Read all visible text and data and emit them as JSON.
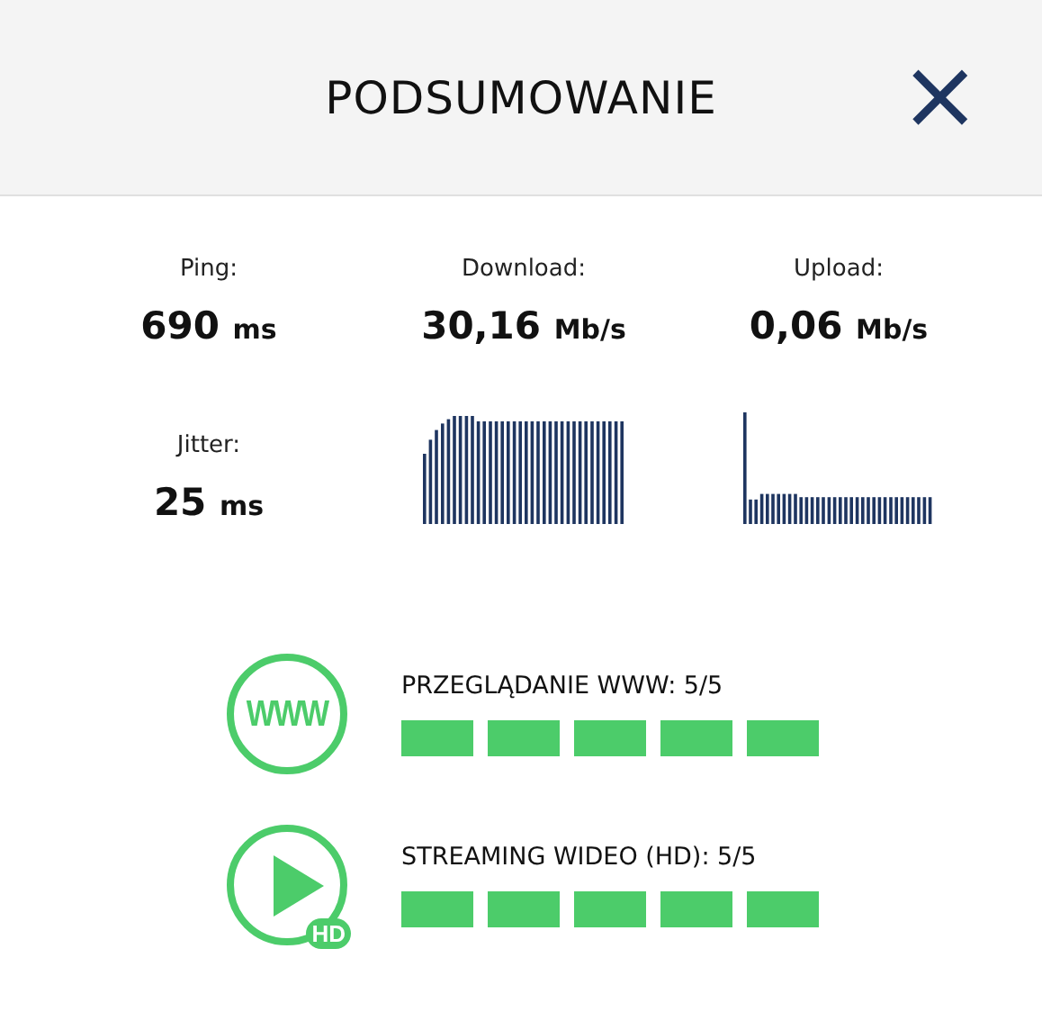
{
  "header": {
    "title": "PODSUMOWANIE",
    "close": "×"
  },
  "stats": [
    {
      "label": "Ping:",
      "value": "690",
      "unit": "ms"
    },
    {
      "label": "Download:",
      "value": "30,16",
      "unit": "Mb/s"
    },
    {
      "label": "Upload:",
      "value": "0,06",
      "unit": "Mb/s"
    },
    {
      "label": "Jitter:",
      "value": "25",
      "unit": "ms"
    }
  ],
  "ratings": [
    {
      "kind": "web",
      "icon_text": "WWW",
      "label": "PRZEGLĄDANIE WWW: 5/5",
      "stars": 5
    },
    {
      "kind": "video",
      "icon_text": "HD",
      "label": "STREAMING WIDEO (HD): 5/5",
      "stars": 5
    }
  ]
}
